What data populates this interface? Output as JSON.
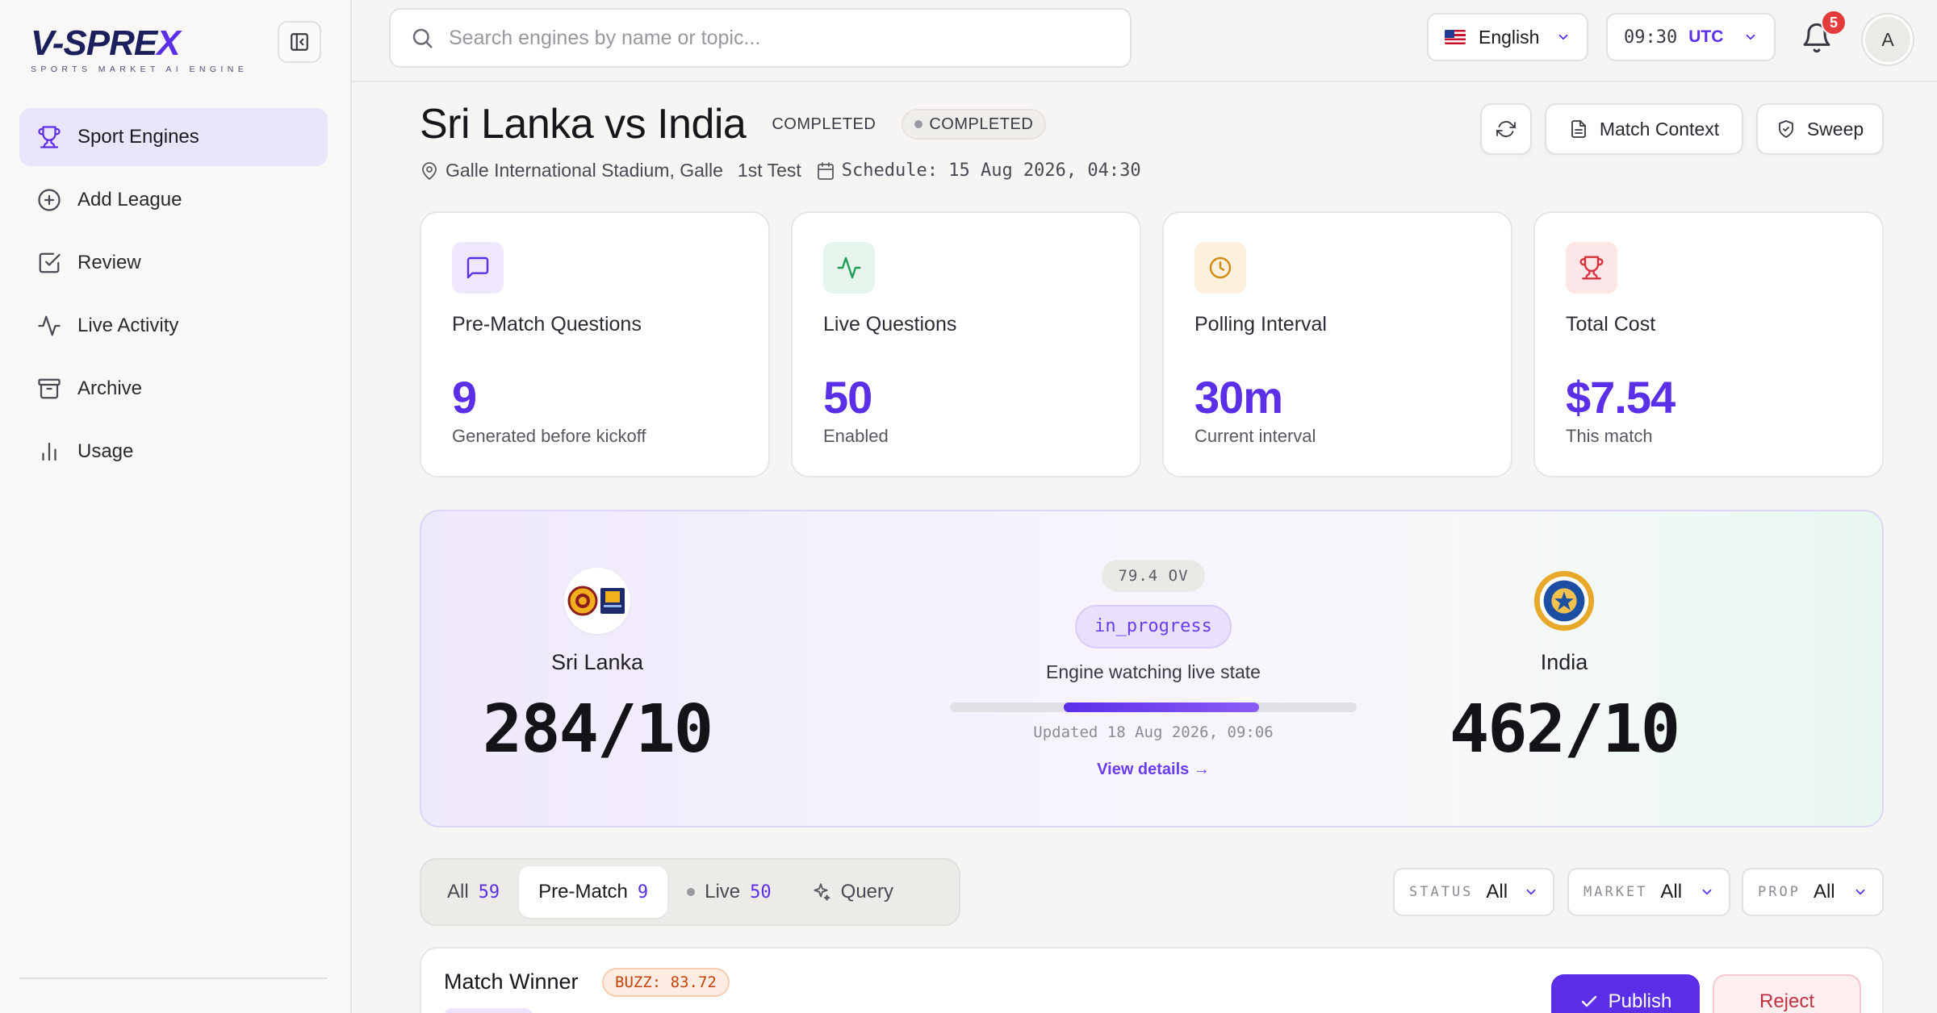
{
  "app": {
    "logo_word_main": "V-SPRE",
    "logo_word_x": "X",
    "tagline": "SPORTS MARKET AI ENGINE"
  },
  "sidebar": {
    "items": [
      {
        "label": "Sport Engines",
        "icon": "trophy-icon",
        "active": true
      },
      {
        "label": "Add League",
        "icon": "plus-circle-icon"
      },
      {
        "label": "Review",
        "icon": "check-square-icon"
      },
      {
        "label": "Live Activity",
        "icon": "activity-icon"
      },
      {
        "label": "Archive",
        "icon": "archive-icon"
      },
      {
        "label": "Usage",
        "icon": "bar-chart-icon"
      }
    ]
  },
  "topbar": {
    "search_placeholder": "Search engines by name or topic...",
    "language": "English",
    "time": "09:30",
    "timezone": "UTC",
    "notification_count": "5",
    "avatar_initial": "A"
  },
  "match": {
    "title": "Sri Lanka vs India",
    "status_text": "COMPLETED",
    "status_chip": "COMPLETED",
    "venue": "Galle International Stadium, Galle",
    "test_label": "1st Test",
    "schedule": "Schedule: 15 Aug 2026, 04:30",
    "actions": {
      "match_context": "Match Context",
      "sweep": "Sweep"
    }
  },
  "stats": [
    {
      "label": "Pre-Match Questions",
      "value": "9",
      "sub": "Generated before kickoff",
      "icon": "message-square-icon",
      "color": "#5b2ee8"
    },
    {
      "label": "Live Questions",
      "value": "50",
      "sub": "Enabled",
      "icon": "activity-icon",
      "color": "#1f9d55"
    },
    {
      "label": "Polling Interval",
      "value": "30m",
      "sub": "Current interval",
      "icon": "clock-icon",
      "color": "#d08a12"
    },
    {
      "label": "Total Cost",
      "value": "$7.54",
      "sub": "This match",
      "icon": "trophy-icon",
      "color": "#d6333f"
    }
  ],
  "scoreboard": {
    "home": {
      "name": "Sri Lanka",
      "score": "284/10"
    },
    "away": {
      "name": "India",
      "score": "462/10"
    },
    "overs": "79.4 OV",
    "state": "in_progress",
    "watching": "Engine watching live state",
    "progress": 0.48,
    "updated": "Updated 18 Aug 2026, 09:06",
    "view_details": "View details →"
  },
  "tabs": [
    {
      "label": "All",
      "count": "59"
    },
    {
      "label": "Pre-Match",
      "count": "9",
      "active": true
    },
    {
      "label": "Live",
      "count": "50"
    },
    {
      "label": "Query",
      "count": ""
    }
  ],
  "filters": [
    {
      "key": "STATUS",
      "value": "All"
    },
    {
      "key": "MARKET",
      "value": "All"
    },
    {
      "key": "PROP",
      "value": "All"
    }
  ],
  "question": {
    "title": "Match Winner",
    "buzz": "BUZZ: 83.72",
    "publish": "Publish",
    "reject": "Reject"
  }
}
